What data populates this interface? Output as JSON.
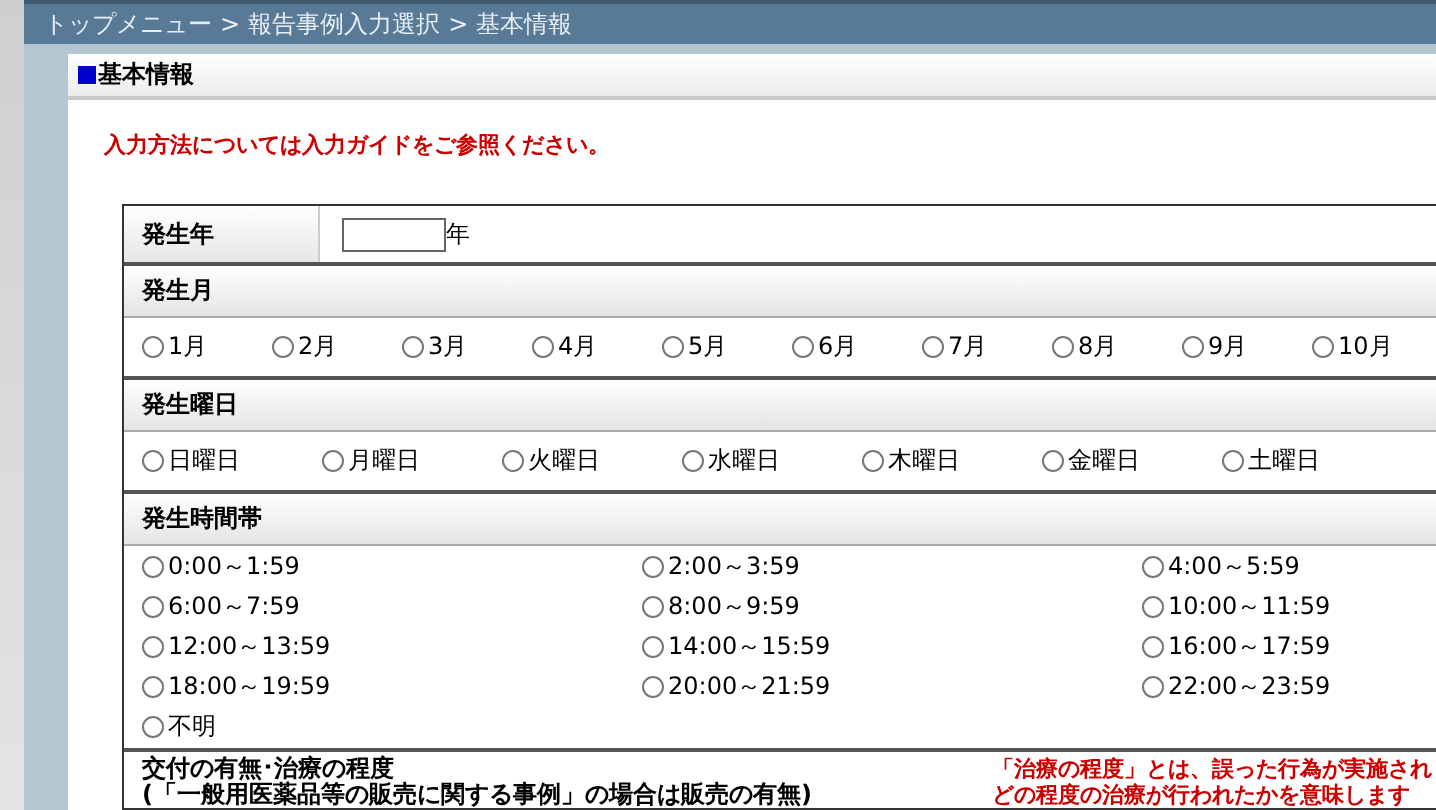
{
  "breadcrumb": {
    "items": [
      "トップメニュー",
      "報告事例入力選択",
      "基本情報"
    ],
    "separator": ">"
  },
  "section_title": "基本情報",
  "notice": "入力方法については入力ガイドをご参照ください。",
  "year": {
    "label": "発生年",
    "unit": "年"
  },
  "month": {
    "label": "発生月",
    "options": [
      {
        "label": "1月",
        "selected": false
      },
      {
        "label": "2月",
        "selected": false
      },
      {
        "label": "3月",
        "selected": false
      },
      {
        "label": "4月",
        "selected": false
      },
      {
        "label": "5月",
        "selected": false
      },
      {
        "label": "6月",
        "selected": false
      },
      {
        "label": "7月",
        "selected": false
      },
      {
        "label": "8月",
        "selected": false
      },
      {
        "label": "9月",
        "selected": false
      },
      {
        "label": "10月",
        "selected": false
      }
    ]
  },
  "weekday": {
    "label": "発生曜日",
    "options": [
      {
        "label": "日曜日",
        "selected": false
      },
      {
        "label": "月曜日",
        "selected": false
      },
      {
        "label": "火曜日",
        "selected": false
      },
      {
        "label": "水曜日",
        "selected": false
      },
      {
        "label": "木曜日",
        "selected": false
      },
      {
        "label": "金曜日",
        "selected": false
      },
      {
        "label": "土曜日",
        "selected": false
      }
    ]
  },
  "time_band": {
    "label": "発生時間帯",
    "options": [
      {
        "label": "0:00～1:59",
        "selected": false
      },
      {
        "label": "2:00～3:59",
        "selected": false
      },
      {
        "label": "4:00～5:59",
        "selected": false
      },
      {
        "label": "6:00～7:59",
        "selected": false
      },
      {
        "label": "8:00～9:59",
        "selected": false
      },
      {
        "label": "10:00～11:59",
        "selected": false
      },
      {
        "label": "12:00～13:59",
        "selected": false
      },
      {
        "label": "14:00～15:59",
        "selected": false
      },
      {
        "label": "16:00～17:59",
        "selected": false
      },
      {
        "label": "18:00～19:59",
        "selected": false
      },
      {
        "label": "20:00～21:59",
        "selected": false
      },
      {
        "label": "22:00～23:59",
        "selected": false
      },
      {
        "label": "不明",
        "selected": false
      }
    ]
  },
  "treatment": {
    "label_lines": [
      "交付の有無･治療の程度",
      "(「一般用医薬品等の販売に関する事例」の場合は販売の有無)"
    ],
    "note_lines": [
      "「治療の程度」とは、誤った行為が実施され",
      "どの程度の治療が行われたかを意味します"
    ]
  }
}
